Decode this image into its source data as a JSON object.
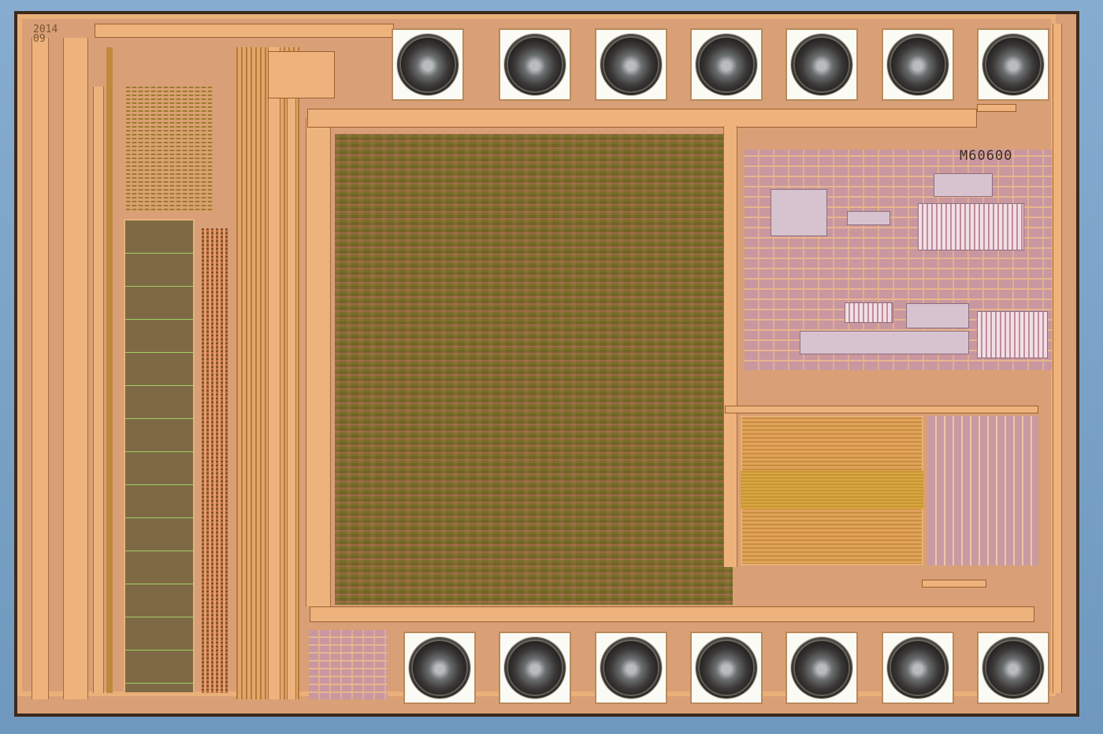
{
  "image": {
    "subject": "integrated-circuit-die",
    "die_marking": "M60600",
    "date_code": "2014\n09",
    "pad_count_top": 7,
    "pad_count_bottom": 7
  },
  "colors": {
    "background": "#7fa6c9",
    "metal": "#e9b07a",
    "logic_fill": "#8c7a33",
    "analog_fill": "#c997a0",
    "pad_fill": "#fbfbf6"
  }
}
